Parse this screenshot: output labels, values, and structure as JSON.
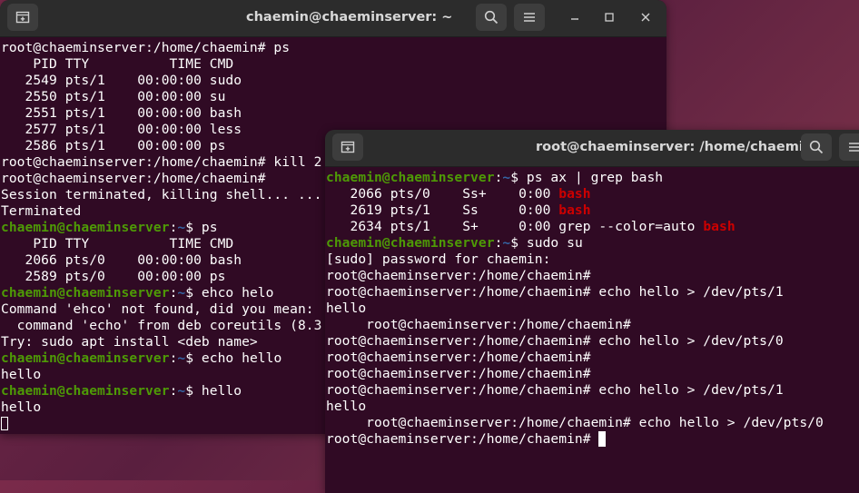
{
  "left_window": {
    "title": "chaemin@chaeminserver: ~",
    "lines": [
      [
        {
          "t": "root@chaeminserver:/home/chaemin# ps"
        }
      ],
      [
        {
          "t": "    PID TTY          TIME CMD"
        }
      ],
      [
        {
          "t": "   2549 pts/1    00:00:00 sudo"
        }
      ],
      [
        {
          "t": "   2550 pts/1    00:00:00 su"
        }
      ],
      [
        {
          "t": "   2551 pts/1    00:00:00 bash"
        }
      ],
      [
        {
          "t": "   2577 pts/1    00:00:00 less"
        }
      ],
      [
        {
          "t": "   2586 pts/1    00:00:00 ps"
        }
      ],
      [
        {
          "t": "root@chaeminserver:/home/chaemin# kill 2"
        }
      ],
      [
        {
          "t": "root@chaeminserver:/home/chaemin#"
        }
      ],
      [
        {
          "t": "Session terminated, killing shell... ..."
        }
      ],
      [
        {
          "t": "Terminated"
        }
      ],
      [
        {
          "t": "chaemin@chaeminserver",
          "c": "g"
        },
        {
          "t": ":"
        },
        {
          "t": "~",
          "c": "b"
        },
        {
          "t": "$ ps"
        }
      ],
      [
        {
          "t": "    PID TTY          TIME CMD"
        }
      ],
      [
        {
          "t": "   2066 pts/0    00:00:00 bash"
        }
      ],
      [
        {
          "t": "   2589 pts/0    00:00:00 ps"
        }
      ],
      [
        {
          "t": "chaemin@chaeminserver",
          "c": "g"
        },
        {
          "t": ":"
        },
        {
          "t": "~",
          "c": "b"
        },
        {
          "t": "$ ehco helo"
        }
      ],
      [
        {
          "t": "Command 'ehco' not found, did you mean:"
        }
      ],
      [
        {
          "t": "  command 'echo' from deb coreutils (8.3"
        }
      ],
      [
        {
          "t": "Try: sudo apt install <deb name>"
        }
      ],
      [
        {
          "t": "chaemin@chaeminserver",
          "c": "g"
        },
        {
          "t": ":"
        },
        {
          "t": "~",
          "c": "b"
        },
        {
          "t": "$ echo hello"
        }
      ],
      [
        {
          "t": "hello"
        }
      ],
      [
        {
          "t": "chaemin@chaeminserver",
          "c": "g"
        },
        {
          "t": ":"
        },
        {
          "t": "~",
          "c": "b"
        },
        {
          "t": "$ hello"
        }
      ],
      [
        {
          "t": "hello"
        }
      ]
    ]
  },
  "right_window": {
    "title": "root@chaeminserver: /home/chaemin",
    "lines": [
      [
        {
          "t": "chaemin@chaeminserver",
          "c": "g"
        },
        {
          "t": ":"
        },
        {
          "t": "~",
          "c": "b"
        },
        {
          "t": "$ ps ax | grep bash"
        }
      ],
      [
        {
          "t": "   2066 pts/0    Ss+    0:00 "
        },
        {
          "t": "bash",
          "c": "r"
        }
      ],
      [
        {
          "t": "   2619 pts/1    Ss     0:00 "
        },
        {
          "t": "bash",
          "c": "r"
        }
      ],
      [
        {
          "t": "   2634 pts/1    S+     0:00 grep --color=auto "
        },
        {
          "t": "bash",
          "c": "r"
        }
      ],
      [
        {
          "t": "chaemin@chaeminserver",
          "c": "g"
        },
        {
          "t": ":"
        },
        {
          "t": "~",
          "c": "b"
        },
        {
          "t": "$ sudo su"
        }
      ],
      [
        {
          "t": "[sudo] password for chaemin:"
        }
      ],
      [
        {
          "t": "root@chaeminserver:/home/chaemin#"
        }
      ],
      [
        {
          "t": "root@chaeminserver:/home/chaemin# echo hello > /dev/pts/1"
        }
      ],
      [
        {
          "t": "hello"
        }
      ],
      [
        {
          "t": "     root@chaeminserver:/home/chaemin#"
        }
      ],
      [
        {
          "t": "root@chaeminserver:/home/chaemin# echo hello > /dev/pts/0"
        }
      ],
      [
        {
          "t": "root@chaeminserver:/home/chaemin#"
        }
      ],
      [
        {
          "t": "root@chaeminserver:/home/chaemin#"
        }
      ],
      [
        {
          "t": "root@chaeminserver:/home/chaemin# echo hello > /dev/pts/1"
        }
      ],
      [
        {
          "t": "hello"
        }
      ],
      [
        {
          "t": "     root@chaeminserver:/home/chaemin# echo hello > /dev/pts/0"
        }
      ],
      [
        {
          "t": "root@chaeminserver:/home/chaemin# "
        }
      ]
    ]
  },
  "icons": {
    "new_tab": "new-tab-icon",
    "search": "search-icon",
    "menu": "hamburger-menu-icon",
    "minimize": "minimize-icon",
    "maximize": "maximize-icon",
    "close": "close-icon"
  },
  "colors": {
    "terminal_bg": "#300a24",
    "titlebar_bg": "#2c2c2c",
    "prompt_user": "#4e9a06",
    "prompt_path": "#3465a4",
    "grep_match": "#cc0000"
  }
}
